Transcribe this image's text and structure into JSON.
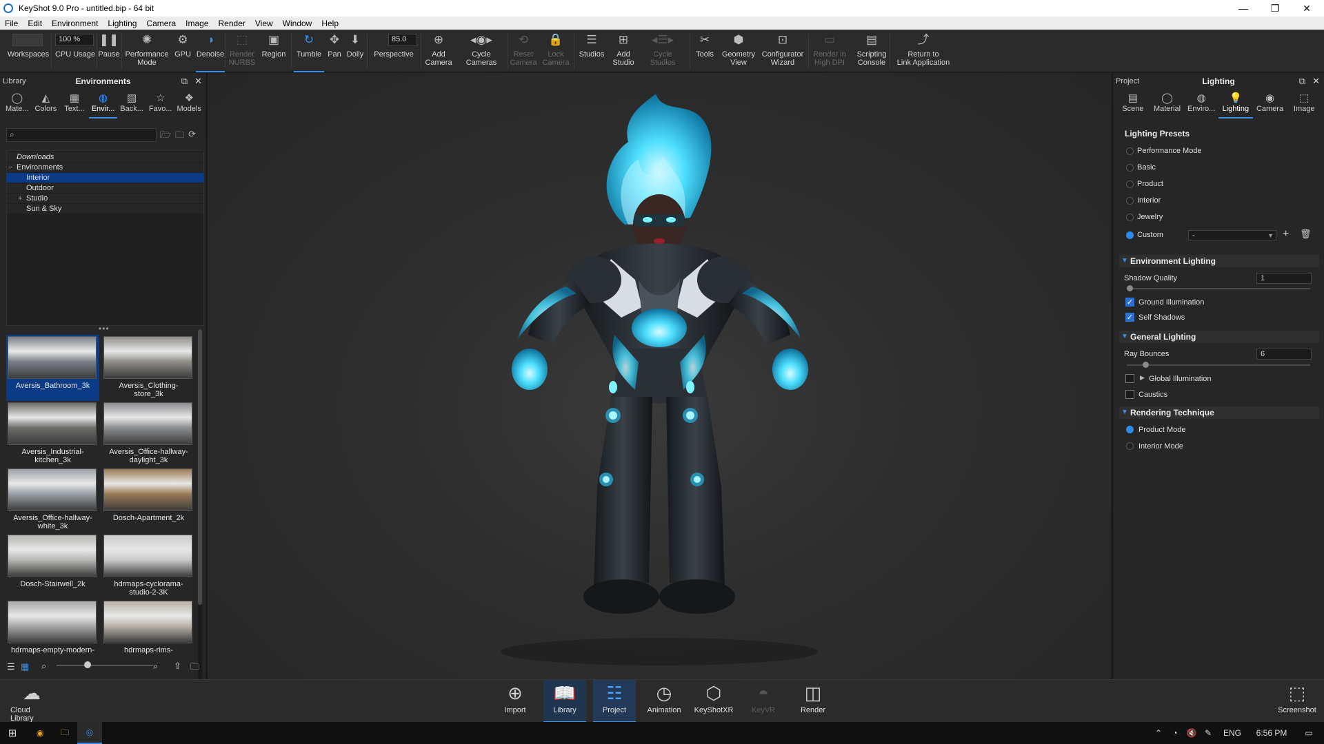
{
  "window": {
    "title": "KeyShot 9.0 Pro  - untitled.bip - 64 bit",
    "minimize": "—",
    "maximize": "❐",
    "close": "✕"
  },
  "menu": [
    "File",
    "Edit",
    "Environment",
    "Lighting",
    "Camera",
    "Image",
    "Render",
    "View",
    "Window",
    "Help"
  ],
  "toolbar": {
    "cpu_value": "100 %",
    "fov_value": "85.0",
    "items": [
      {
        "label": "Workspaces",
        "icon": "workspaces-icon",
        "glyph": "▭"
      },
      {
        "label": "CPU Usage",
        "icon": "cpu-usage-icon",
        "glyph": ""
      },
      {
        "label": "Pause",
        "icon": "pause-icon",
        "glyph": "❚❚"
      },
      {
        "label": "Performance\nMode",
        "icon": "performance-mode-icon",
        "glyph": "✺"
      },
      {
        "label": "GPU",
        "icon": "gpu-icon",
        "glyph": "⚙"
      },
      {
        "label": "Denoise",
        "icon": "denoise-icon",
        "glyph": "◑"
      },
      {
        "label": "Render\nNURBS",
        "icon": "render-nurbs-icon",
        "glyph": "⬚"
      },
      {
        "label": "Region",
        "icon": "region-icon",
        "glyph": "▣"
      },
      {
        "label": "Tumble",
        "icon": "tumble-icon",
        "glyph": "↻"
      },
      {
        "label": "Pan",
        "icon": "pan-icon",
        "glyph": "✥"
      },
      {
        "label": "Dolly",
        "icon": "dolly-icon",
        "glyph": "⬇"
      },
      {
        "label": "Perspective",
        "icon": "perspective-icon",
        "glyph": "⊞"
      },
      {
        "label": "Add\nCamera",
        "icon": "add-camera-icon",
        "glyph": "⊕"
      },
      {
        "label": "Cycle\nCameras",
        "icon": "cycle-cameras-icon",
        "glyph": "◂◉▸"
      },
      {
        "label": "Reset\nCamera",
        "icon": "reset-camera-icon",
        "glyph": "⟲"
      },
      {
        "label": "Lock\nCamera",
        "icon": "lock-camera-icon",
        "glyph": "🔒"
      },
      {
        "label": "Studios",
        "icon": "studios-icon",
        "glyph": "☰"
      },
      {
        "label": "Add\nStudio",
        "icon": "add-studio-icon",
        "glyph": "⊞"
      },
      {
        "label": "Cycle\nStudios",
        "icon": "cycle-studios-icon",
        "glyph": "◂☰▸"
      },
      {
        "label": "Tools",
        "icon": "tools-icon",
        "glyph": "✂"
      },
      {
        "label": "Geometry\nView",
        "icon": "geometry-view-icon",
        "glyph": "⬢"
      },
      {
        "label": "Configurator\nWizard",
        "icon": "configurator-wizard-icon",
        "glyph": "⊡"
      },
      {
        "label": "Render in\nHigh DPI",
        "icon": "render-high-dpi-icon",
        "glyph": "▭"
      },
      {
        "label": "Scripting\nConsole",
        "icon": "scripting-console-icon",
        "glyph": "▤"
      },
      {
        "label": "Return to\nLink Application",
        "icon": "return-link-icon",
        "glyph": "⤴"
      }
    ]
  },
  "library": {
    "header_left": "Library",
    "header_title": "Environments",
    "tabs": [
      {
        "label": "Mate...",
        "icon": "materials-icon",
        "glyph": "◯"
      },
      {
        "label": "Colors",
        "icon": "colors-icon",
        "glyph": "◭"
      },
      {
        "label": "Text...",
        "icon": "textures-icon",
        "glyph": "▦"
      },
      {
        "label": "Envir...",
        "icon": "environments-icon",
        "glyph": "◍"
      },
      {
        "label": "Back...",
        "icon": "backplates-icon",
        "glyph": "▨"
      },
      {
        "label": "Favo...",
        "icon": "favorites-icon",
        "glyph": "☆"
      },
      {
        "label": "Models",
        "icon": "models-icon",
        "glyph": "❖"
      }
    ],
    "search_placeholder": "",
    "tree": [
      {
        "label": "Downloads",
        "expander": "",
        "indent": 0,
        "italic": true
      },
      {
        "label": "Environments",
        "expander": "−",
        "indent": 0
      },
      {
        "label": "Interior",
        "expander": "",
        "indent": 1,
        "selected": true
      },
      {
        "label": "Outdoor",
        "expander": "",
        "indent": 1
      },
      {
        "label": "Studio",
        "expander": "+",
        "indent": 1
      },
      {
        "label": "Sun & Sky",
        "expander": "",
        "indent": 1
      }
    ],
    "thumbnails": [
      {
        "name": "Aversis_Bathroom_3k",
        "selected": true,
        "tone": "#7a7f86"
      },
      {
        "name": "Aversis_Clothing-\nstore_3k",
        "tone": "#8f8c86"
      },
      {
        "name": "Aversis_Industrial-\nkitchen_3k",
        "tone": "#6d6d6a"
      },
      {
        "name": "Aversis_Office-hallway-\ndaylight_3k",
        "tone": "#8b8d90"
      },
      {
        "name": "Aversis_Office-hallway-\nwhite_3k",
        "tone": "#9aa0a6"
      },
      {
        "name": "Dosch-Apartment_2k",
        "tone": "#9a7a55"
      },
      {
        "name": "Dosch-Stairwell_2k",
        "tone": "#b5b5b2"
      },
      {
        "name": "hdrmaps-cyclorama-\nstudio-2-3K",
        "tone": "#c9c9c9"
      },
      {
        "name": "hdrmaps-empty-modern-",
        "tone": "#a8a8a8"
      },
      {
        "name": "hdrmaps-rims-",
        "tone": "#b8b1a6"
      }
    ]
  },
  "project": {
    "header_left": "Project",
    "header_title": "Lighting",
    "tabs": [
      {
        "label": "Scene",
        "icon": "scene-icon",
        "glyph": "▤"
      },
      {
        "label": "Material",
        "icon": "material-icon",
        "glyph": "◯"
      },
      {
        "label": "Enviro...",
        "icon": "environment-icon",
        "glyph": "◍"
      },
      {
        "label": "Lighting",
        "icon": "lighting-icon",
        "glyph": "💡"
      },
      {
        "label": "Camera",
        "icon": "camera-icon",
        "glyph": "◉"
      },
      {
        "label": "Image",
        "icon": "image-icon",
        "glyph": "⬚"
      }
    ],
    "presets_title": "Lighting Presets",
    "presets": [
      {
        "label": "Performance Mode",
        "selected": false
      },
      {
        "label": "Basic",
        "selected": false
      },
      {
        "label": "Product",
        "selected": false
      },
      {
        "label": "Interior",
        "selected": false
      },
      {
        "label": "Jewelry",
        "selected": false
      },
      {
        "label": "Custom",
        "selected": true
      }
    ],
    "custom_value": "-",
    "environment_lighting": {
      "title": "Environment Lighting",
      "shadow_quality_label": "Shadow Quality",
      "shadow_quality_value": "1",
      "ground_illumination": {
        "label": "Ground Illumination",
        "checked": true
      },
      "self_shadows": {
        "label": "Self Shadows",
        "checked": true
      }
    },
    "general_lighting": {
      "title": "General Lighting",
      "ray_bounces_label": "Ray Bounces",
      "ray_bounces_value": "6",
      "global_illumination": {
        "label": "Global Illumination",
        "checked": false
      },
      "caustics": {
        "label": "Caustics",
        "checked": false
      }
    },
    "rendering_technique": {
      "title": "Rendering Technique",
      "options": [
        {
          "label": "Product Mode",
          "selected": true
        },
        {
          "label": "Interior Mode",
          "selected": false
        }
      ]
    }
  },
  "bottombar": {
    "cloud_library": "Cloud Library",
    "screenshot": "Screenshot",
    "items": [
      {
        "label": "Import",
        "icon": "import-icon",
        "glyph": "⊕",
        "state": ""
      },
      {
        "label": "Library",
        "icon": "library-icon",
        "glyph": "📖",
        "state": "on"
      },
      {
        "label": "Project",
        "icon": "project-icon",
        "glyph": "☷",
        "state": "on"
      },
      {
        "label": "Animation",
        "icon": "animation-icon",
        "glyph": "◷",
        "state": ""
      },
      {
        "label": "KeyShotXR",
        "icon": "keyshotxr-icon",
        "glyph": "⬡",
        "state": ""
      },
      {
        "label": "KeyVR",
        "icon": "keyvr-icon",
        "glyph": "◓",
        "state": "dis"
      },
      {
        "label": "Render",
        "icon": "render-icon",
        "glyph": "◫",
        "state": ""
      }
    ]
  },
  "taskbar": {
    "language": "ENG",
    "time": "6:56 PM"
  },
  "colors": {
    "accent": "#3a8ee6",
    "glow": "#35d6ff",
    "selection": "#0b3b86"
  }
}
